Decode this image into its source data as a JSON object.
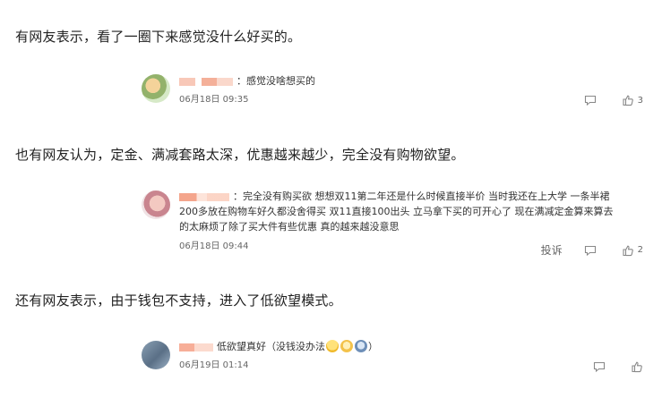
{
  "paragraphs": [
    "有网友表示，看了一圈下来感觉没什么好买的。",
    "也有网友认为，定金、满减套路太深，优惠越来越少，完全没有购物欲望。",
    "还有网友表示，由于钱包不支持，进入了低欲望模式。"
  ],
  "comments": [
    {
      "text": "：感觉没啥想买的",
      "date": "06月18日 09:35",
      "likes": "3"
    },
    {
      "text": "：完全没有购买欲 想想双11第二年还是什么时候直接半价 当时我还在上大学 一条半裙200多放在购物车好久都没舍得买 双11直接100出头 立马拿下买的可开心了 现在满减定金算来算去的太麻烦了除了买大件有些优惠 真的越来越没意思",
      "date": "06月18日 09:44",
      "report_label": "投诉",
      "likes": "2"
    },
    {
      "text": "低欲望真好（没钱没办法",
      "text_end": "）",
      "date": "06月19日 01:14"
    }
  ],
  "icons": {
    "reply": "comment-bubble-icon",
    "like": "thumbs-up-icon"
  }
}
